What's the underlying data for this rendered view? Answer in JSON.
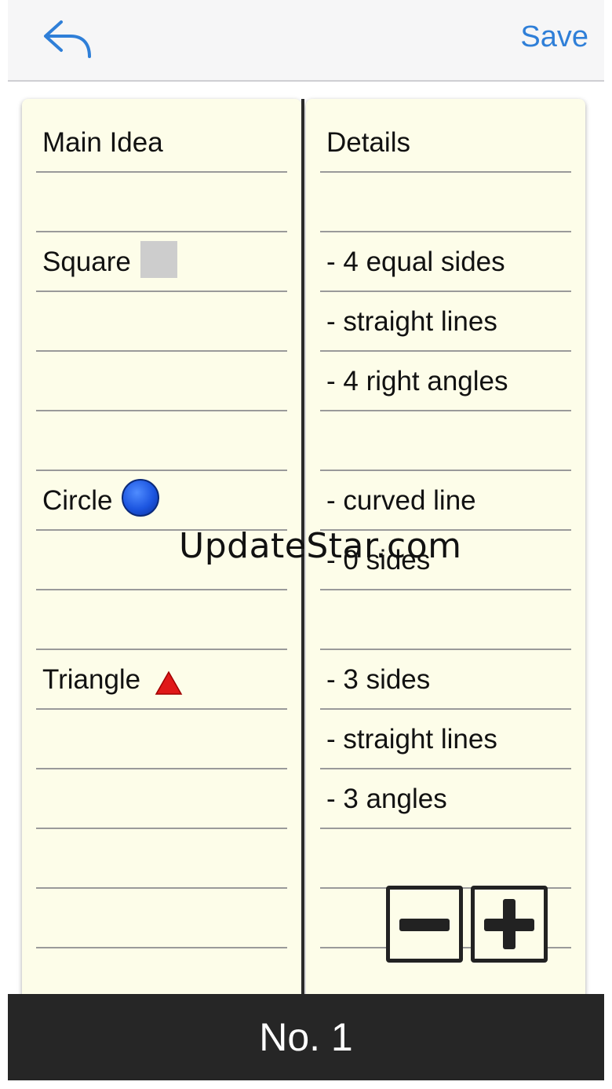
{
  "toolbar": {
    "back_icon": "back-arrow-icon",
    "save_label": "Save",
    "accent_color": "#2f7fd8"
  },
  "main_column": {
    "header": "Main Idea",
    "items": [
      {
        "label": "Square",
        "icon": "square-icon"
      },
      {
        "label": "Circle",
        "icon": "blue-circle-icon"
      },
      {
        "label": "Triangle",
        "icon": "red-triangle-icon"
      }
    ]
  },
  "details_column": {
    "header": "Details",
    "lines": [
      "- 4 equal sides",
      "- straight lines",
      "- 4 right angles",
      "- curved line",
      "- 0 sides",
      "- 3 sides",
      "- straight lines",
      "- 3 angles"
    ]
  },
  "watermark": "UpdateStar.com",
  "controls": {
    "minus_icon": "minus-icon",
    "plus_icon": "plus-icon"
  },
  "footer": {
    "title": "No. 1"
  },
  "colors": {
    "paper": "#fdfde9",
    "footer_bg": "#262626",
    "ruled_line": "#9a9a9a"
  }
}
